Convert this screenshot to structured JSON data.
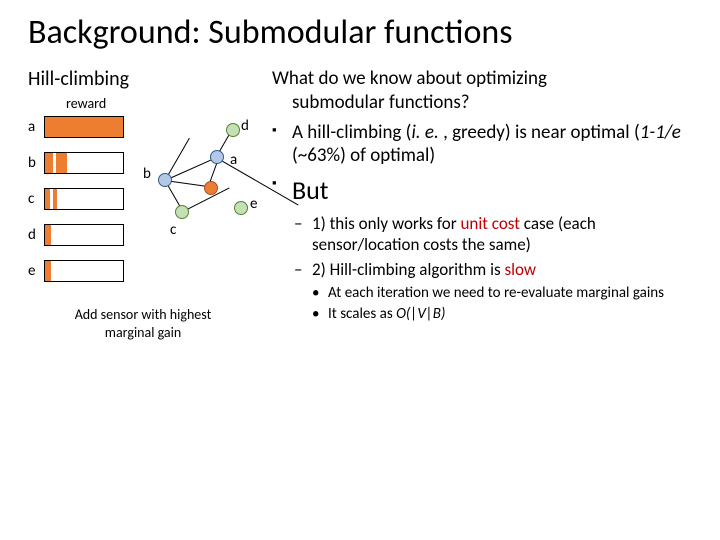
{
  "title": "Background: Submodular functions",
  "left": {
    "heading": "Hill-climbing",
    "reward_label": "reward",
    "bars": [
      {
        "label": "a",
        "fill": 1.0
      },
      {
        "label": "b",
        "fill": 0.25
      },
      {
        "label": "c",
        "fill": 0.1
      },
      {
        "label": "d",
        "fill": 0.05
      },
      {
        "label": "e",
        "fill": 0.05
      }
    ],
    "graph": {
      "a": "a",
      "b": "b",
      "c": "c",
      "d": "d",
      "e": "e"
    },
    "caption_l1": "Add sensor with highest",
    "caption_l2": "marginal gain"
  },
  "right": {
    "q1": "What do we know about optimizing",
    "q2": "submodular functions?",
    "p1a": "A hill-climbing (",
    "p1b": "i. e. ",
    "p1c": ", greedy) is near optimal (",
    "p1d": "1-1/e",
    "p1e": " (~63%) of optimal)",
    "but": "But",
    "s1a": "1) this only works for ",
    "s1b": "unit cost",
    "s1c": " case (each sensor/location costs the same)",
    "s2a": "2) Hill-climbing algorithm is ",
    "s2b": "slow",
    "b1": "At each iteration we need to re-evaluate marginal gains",
    "b2a": "It scales as ",
    "b2b": "O(|V|B)"
  }
}
